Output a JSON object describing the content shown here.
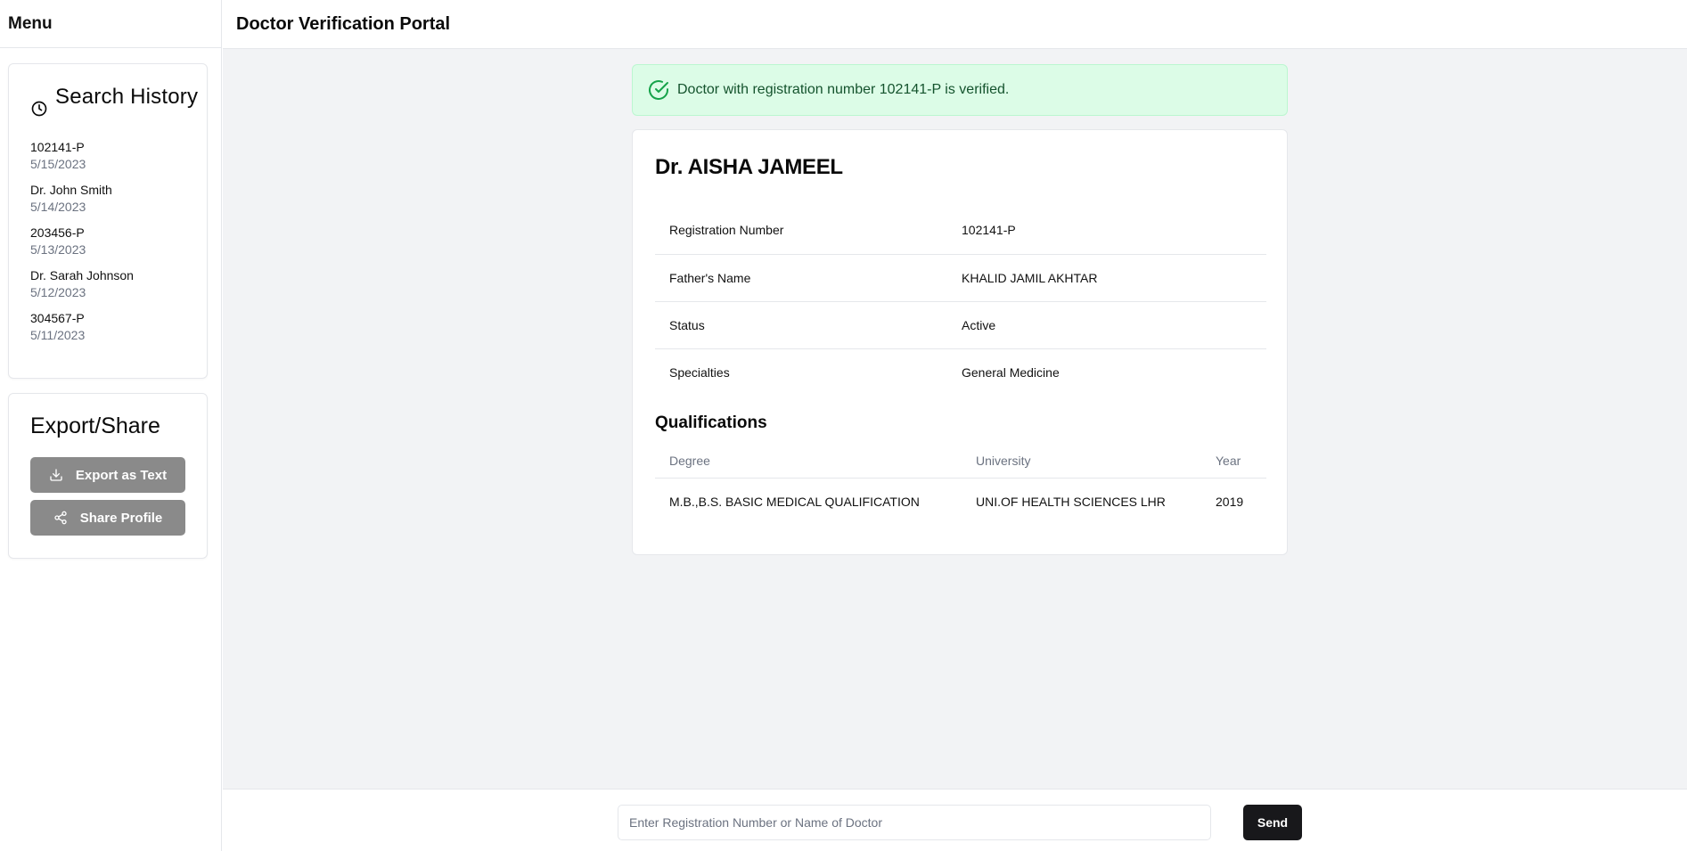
{
  "sidebar": {
    "menu_label": "Menu",
    "history": {
      "title": "Search History",
      "items": [
        {
          "query": "102141-P",
          "date": "5/15/2023"
        },
        {
          "query": "Dr. John Smith",
          "date": "5/14/2023"
        },
        {
          "query": "203456-P",
          "date": "5/13/2023"
        },
        {
          "query": "Dr. Sarah Johnson",
          "date": "5/12/2023"
        },
        {
          "query": "304567-P",
          "date": "5/11/2023"
        }
      ]
    },
    "export": {
      "title": "Export/Share",
      "export_label": "Export as Text",
      "share_label": "Share Profile"
    }
  },
  "header": {
    "title": "Doctor Verification Portal"
  },
  "alert": {
    "message": "Doctor with registration number 102141-P is verified.",
    "color": "#16a34a"
  },
  "profile": {
    "name": "Dr. AISHA JAMEEL",
    "fields": [
      {
        "label": "Registration Number",
        "value": "102141-P"
      },
      {
        "label": "Father's Name",
        "value": "KHALID JAMIL AKHTAR"
      },
      {
        "label": "Status",
        "value": "Active"
      },
      {
        "label": "Specialties",
        "value": "General Medicine"
      }
    ],
    "qualifications": {
      "title": "Qualifications",
      "headers": {
        "degree": "Degree",
        "university": "University",
        "year": "Year"
      },
      "rows": [
        {
          "degree": "M.B.,B.S. BASIC MEDICAL QUALIFICATION",
          "university": "UNI.OF HEALTH SCIENCES LHR",
          "year": "2019"
        }
      ]
    }
  },
  "search": {
    "placeholder": "Enter Registration Number or Name of Doctor",
    "value": "",
    "send_label": "Send"
  }
}
